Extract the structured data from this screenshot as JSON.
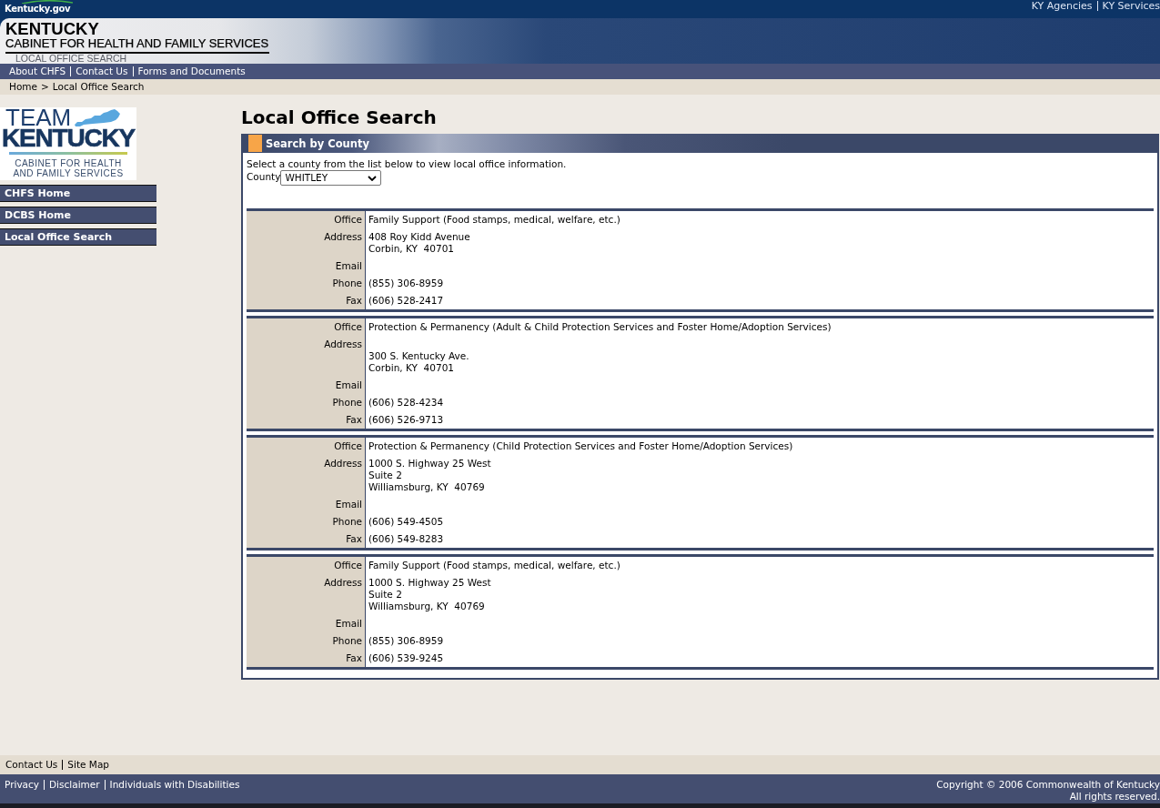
{
  "top_bar": {
    "portal_logo": "Kentucky.gov",
    "links": [
      "KY Agencies",
      "KY Services"
    ]
  },
  "banner": {
    "title": "KENTUCKY",
    "subtitle": "CABINET FOR HEALTH AND FAMILY SERVICES",
    "section": "LOCAL OFFICE SEARCH"
  },
  "nav_bar": {
    "links": [
      "About CHFS",
      "Contact Us",
      "Forms and Documents"
    ]
  },
  "breadcrumb": {
    "items": [
      "Home",
      "Local Office Search"
    ],
    "separator": ">"
  },
  "sidebar": {
    "logo": {
      "line_1": "TEAM",
      "line_2": "KENTUCKY",
      "tagline": [
        "CABINET FOR HEALTH",
        "AND FAMILY SERVICES"
      ]
    },
    "items": [
      {
        "label": "CHFS Home"
      },
      {
        "label": "DCBS Home"
      },
      {
        "label": "Local Office Search"
      }
    ]
  },
  "page_title": "Local Office Search",
  "panel": {
    "title": "Search by County",
    "intro": "Select a county from the list below to view local office information.",
    "county_field": {
      "label": "County",
      "value": "WHITLEY"
    },
    "offices": [
      {
        "rows": [
          {
            "label": "Office",
            "lines": [
              "Family Support (Food stamps, medical, welfare, etc.)"
            ],
            "leading_blank": false
          },
          {
            "label": "Address",
            "lines": [
              "408 Roy Kidd Avenue",
              "Corbin, KY  40701"
            ],
            "leading_blank": false
          },
          {
            "label": "Email"
          },
          {
            "label": "Phone",
            "lines": [
              "(855) 306-8959"
            ],
            "leading_blank": false
          },
          {
            "label": "Fax",
            "lines": [
              "(606) 528-2417"
            ],
            "leading_blank": false
          }
        ]
      },
      {
        "rows": [
          {
            "label": "Office",
            "lines": [
              "Protection & Permanency (Adult & Child Protection Services and Foster Home/Adoption Services)"
            ],
            "leading_blank": false
          },
          {
            "label": "Address",
            "lines": [
              "300 S. Kentucky Ave.",
              "Corbin, KY  40701"
            ],
            "leading_blank": true
          },
          {
            "label": "Email"
          },
          {
            "label": "Phone",
            "lines": [
              "(606) 528-4234"
            ],
            "leading_blank": false
          },
          {
            "label": "Fax",
            "lines": [
              "(606) 526-9713"
            ],
            "leading_blank": false
          }
        ]
      },
      {
        "rows": [
          {
            "label": "Office",
            "lines": [
              "Protection & Permanency (Child Protection Services and Foster Home/Adoption Services)"
            ],
            "leading_blank": false
          },
          {
            "label": "Address",
            "lines": [
              "1000 S. Highway 25 West",
              "Suite 2",
              "Williamsburg, KY  40769"
            ],
            "leading_blank": false
          },
          {
            "label": "Email"
          },
          {
            "label": "Phone",
            "lines": [
              "(606) 549-4505"
            ],
            "leading_blank": false
          },
          {
            "label": "Fax",
            "lines": [
              "(606) 549-8283"
            ],
            "leading_blank": false
          }
        ]
      },
      {
        "rows": [
          {
            "label": "Office",
            "lines": [
              "Family Support (Food stamps, medical, welfare, etc.)"
            ],
            "leading_blank": false
          },
          {
            "label": "Address",
            "lines": [
              "1000 S. Highway 25 West",
              "Suite 2",
              "Williamsburg, KY  40769"
            ],
            "leading_blank": false
          },
          {
            "label": "Email"
          },
          {
            "label": "Phone",
            "lines": [
              "(855) 306-8959"
            ],
            "leading_blank": false
          },
          {
            "label": "Fax",
            "lines": [
              "(606) 539-9245"
            ],
            "leading_blank": false
          }
        ]
      }
    ]
  },
  "footer": {
    "links": [
      "Contact Us",
      "Site Map"
    ],
    "legal_links": [
      "Privacy",
      "Disclaimer",
      "Individuals with Disabilities"
    ],
    "copyright": [
      "Copyright © 2006 Commonwealth of Kentucky",
      "All rights reserved."
    ]
  }
}
